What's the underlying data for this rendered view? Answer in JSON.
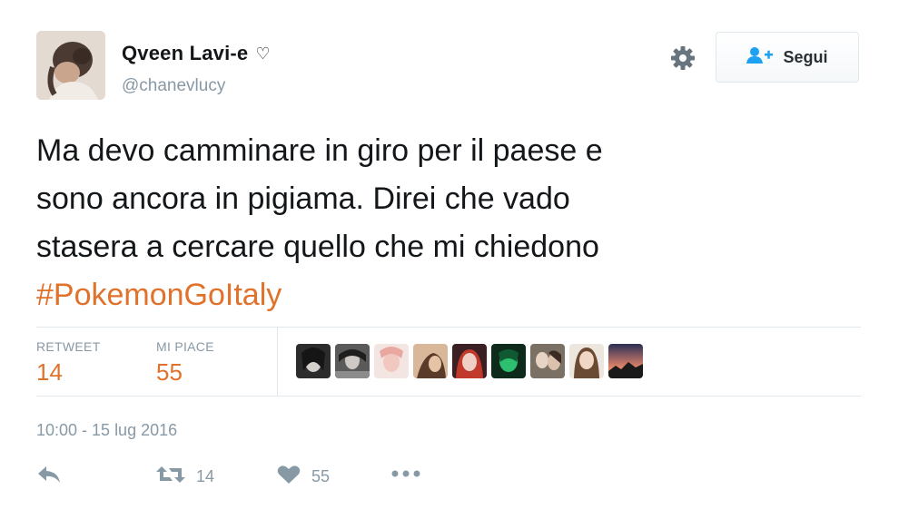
{
  "user": {
    "display_name": "Qveen Lavi-e",
    "name_symbol": "♡",
    "handle": "@chanevlucy"
  },
  "follow_button": {
    "label": "Segui"
  },
  "tweet": {
    "lines": [
      "Ma devo camminare in giro per il paese e",
      "sono ancora in pigiama. Direi che vado",
      "stasera a cercare quello che mi chiedono"
    ],
    "hashtag": "#PokemonGoItaly"
  },
  "stats": {
    "retweet_label": "RETWEET",
    "retweet_count": "14",
    "likes_label": "MI PIACE",
    "likes_count": "55"
  },
  "timestamp": "10:00 - 15 lug 2016",
  "actions": {
    "retweet_count": "14",
    "like_count": "55"
  },
  "colors": {
    "link": "#e0722c",
    "muted": "#8899a6",
    "text": "#14171a",
    "border": "#e1e8ed"
  },
  "icons": [
    "gear-icon",
    "follow-user-icon",
    "reply-icon",
    "retweet-icon",
    "heart-icon",
    "more-icon"
  ]
}
